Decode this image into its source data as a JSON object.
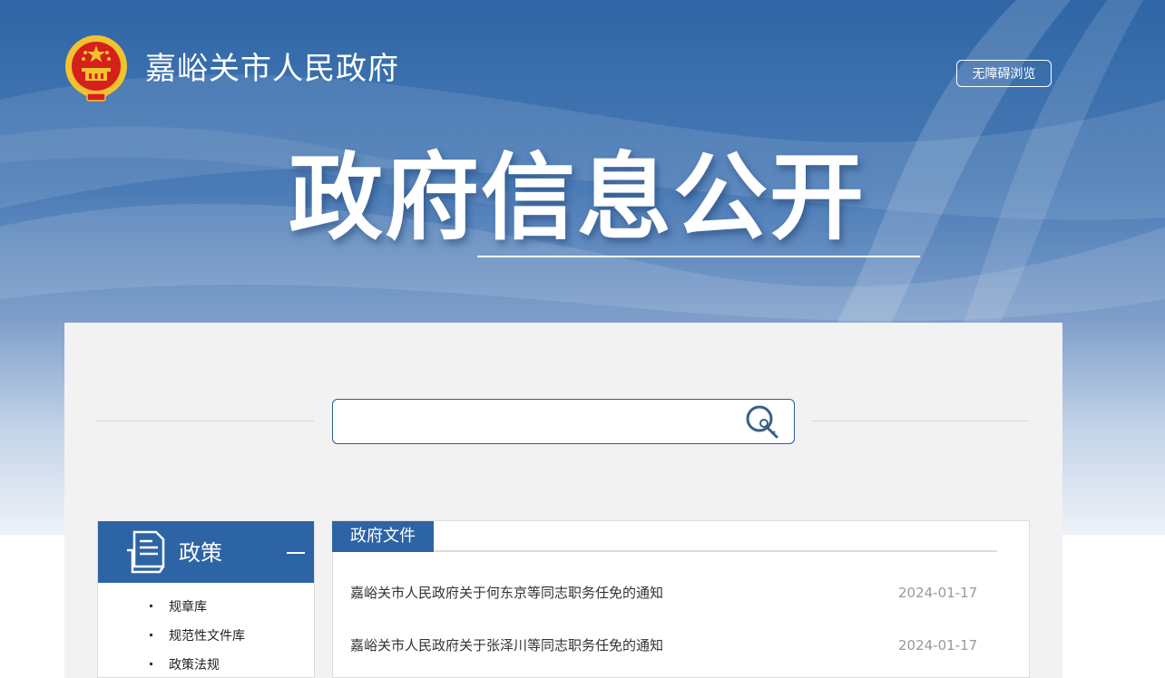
{
  "header": {
    "site_title": "嘉峪关市人民政府",
    "accessibility_label": "无障碍浏览"
  },
  "hero": {
    "title": "政府信息公开"
  },
  "search": {
    "value": "",
    "placeholder": ""
  },
  "sidebar": {
    "title": "政策",
    "items": [
      {
        "label": "规章库"
      },
      {
        "label": "规范性文件库"
      },
      {
        "label": "政策法规"
      }
    ]
  },
  "main": {
    "tab_label": "政府文件",
    "news": [
      {
        "title": "嘉峪关市人民政府关于何东京等同志职务任免的通知",
        "date": "2024-01-17"
      },
      {
        "title": "嘉峪关市人民政府关于张泽川等同志职务任免的通知",
        "date": "2024-01-17"
      }
    ]
  },
  "colors": {
    "primary_blue": "#2d64a5",
    "emblem_red": "#d6201b",
    "emblem_gold": "#f2c230"
  },
  "icons": [
    "national-emblem-icon",
    "search-icon",
    "document-icon",
    "collapse-icon"
  ]
}
